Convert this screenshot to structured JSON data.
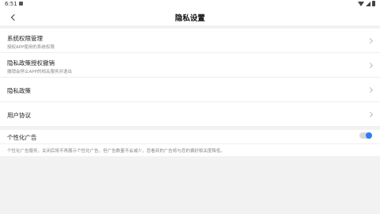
{
  "status_bar": {
    "time": "6:51"
  },
  "header": {
    "title": "隐私设置"
  },
  "list": {
    "items": [
      {
        "title": "系统权限管理",
        "subtitle": "授权APP使用的系统权限"
      },
      {
        "title": "隐私政策授权撤销",
        "subtitle": "撤销会停止APP的相关服务并退出"
      },
      {
        "title": "隐私政策"
      },
      {
        "title": "用户协议"
      }
    ]
  },
  "personalized_ads": {
    "title": "个性化广告",
    "enabled": true,
    "description": "个性化广告服务，关闭后将不再展示个性化广告，但广告数量不会减少，您看到的广告将与您的偏好相关度降低。",
    "toggle_color": "#2f7bf5"
  }
}
